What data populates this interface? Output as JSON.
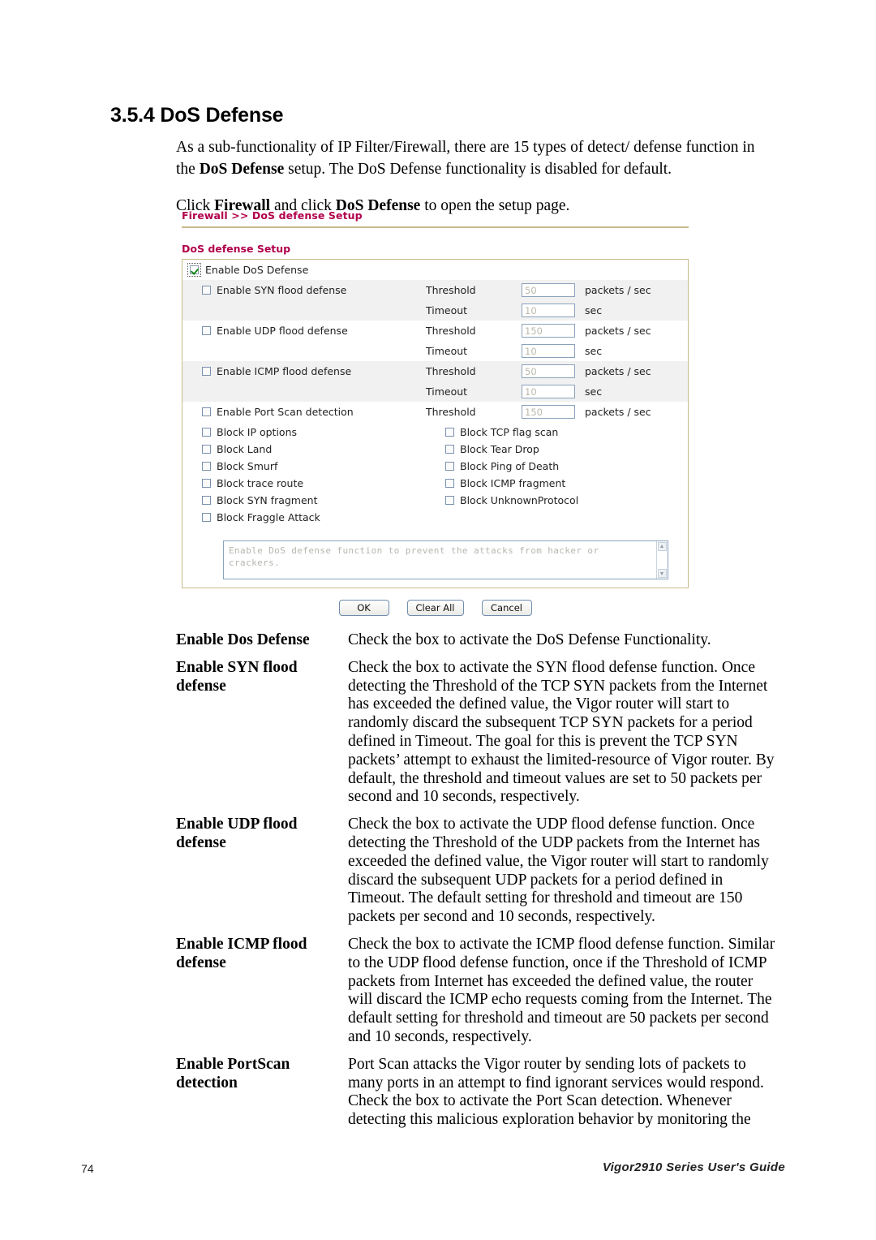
{
  "section": {
    "number": "3.5.4",
    "title": "3.5.4 DoS Defense"
  },
  "intro": {
    "paragraph1_pre": "As a sub-functionality of IP Filter/Firewall, there are 15 types of detect/ defense function in the ",
    "paragraph1_bold": "DoS Defense",
    "paragraph1_post": " setup. The DoS Defense functionality is disabled for default.",
    "paragraph2_pre": "Click ",
    "paragraph2_bold1": "Firewall",
    "paragraph2_mid": " and click ",
    "paragraph2_bold2": "DoS Defense",
    "paragraph2_post": " to open the setup page."
  },
  "screenshot": {
    "breadcrumb": "Firewall >> DoS defense Setup",
    "panel_title": "DoS defense Setup",
    "master_checkbox": {
      "label": "Enable DoS Defense",
      "checked": true
    },
    "flood_rows": [
      {
        "label": "Enable SYN flood defense",
        "checked": false,
        "threshold_label": "Threshold",
        "threshold_value": "50",
        "threshold_unit": "packets / sec",
        "timeout_label": "Timeout",
        "timeout_value": "10",
        "timeout_unit": "sec"
      },
      {
        "label": "Enable UDP flood defense",
        "checked": false,
        "threshold_label": "Threshold",
        "threshold_value": "150",
        "threshold_unit": "packets / sec",
        "timeout_label": "Timeout",
        "timeout_value": "10",
        "timeout_unit": "sec"
      },
      {
        "label": "Enable ICMP flood defense",
        "checked": false,
        "threshold_label": "Threshold",
        "threshold_value": "50",
        "threshold_unit": "packets / sec",
        "timeout_label": "Timeout",
        "timeout_value": "10",
        "timeout_unit": "sec"
      }
    ],
    "portscan_row": {
      "label": "Enable Port Scan detection",
      "checked": false,
      "threshold_label": "Threshold",
      "threshold_value": "150",
      "threshold_unit": "packets / sec"
    },
    "block_left": [
      {
        "label": "Block IP options",
        "checked": false
      },
      {
        "label": "Block Land",
        "checked": false
      },
      {
        "label": "Block Smurf",
        "checked": false
      },
      {
        "label": "Block trace route",
        "checked": false
      },
      {
        "label": "Block SYN fragment",
        "checked": false
      },
      {
        "label": "Block Fraggle Attack",
        "checked": false
      }
    ],
    "block_right": [
      {
        "label": "Block TCP flag scan",
        "checked": false
      },
      {
        "label": "Block Tear Drop",
        "checked": false
      },
      {
        "label": "Block Ping of Death",
        "checked": false
      },
      {
        "label": "Block ICMP fragment",
        "checked": false
      },
      {
        "label": "Block UnknownProtocol",
        "checked": false
      }
    ],
    "note_text": "Enable DoS defense function to prevent the attacks from hacker or crackers.",
    "buttons": {
      "ok": "OK",
      "clear_all": "Clear All",
      "cancel": "Cancel"
    },
    "colors": {
      "accent": "#b1004b",
      "panel_border": "#c8bb8a",
      "row_shade": "#f1f1f1",
      "check_green": "#1a8b1a"
    }
  },
  "definitions": [
    {
      "term": "Enable Dos Defense",
      "description": "Check the box to activate the DoS Defense Functionality."
    },
    {
      "term": "Enable SYN flood defense",
      "description": "Check the box to activate the SYN flood defense function. Once detecting the Threshold of the TCP SYN packets from the Internet has exceeded the defined value, the Vigor router will start to randomly discard the subsequent TCP SYN packets for a period defined in Timeout. The goal for this is prevent the TCP SYN packets’ attempt to exhaust the limited-resource of Vigor router. By default, the threshold and timeout values are set to 50 packets per second and 10 seconds, respectively."
    },
    {
      "term": "Enable UDP flood defense",
      "description": "Check the box to activate the UDP flood defense function. Once detecting the Threshold of the UDP packets from the Internet has exceeded the defined value, the Vigor router will start to randomly discard the subsequent UDP packets for a period defined in Timeout. The default setting for threshold and timeout are 150 packets per second and 10 seconds, respectively."
    },
    {
      "term": "Enable ICMP flood defense",
      "description": "Check the box to activate the ICMP flood defense function. Similar to the UDP flood defense function, once if the Threshold of ICMP packets from Internet has exceeded the defined value, the router will discard the ICMP echo requests coming from the Internet. The default setting for threshold and timeout are 50 packets per second and 10 seconds, respectively."
    },
    {
      "term": "Enable PortScan detection",
      "description": "Port Scan attacks the Vigor router by sending lots of packets to many ports in an attempt to find ignorant services would respond. Check the box to activate the Port Scan detection. Whenever detecting this malicious exploration behavior by monitoring the"
    }
  ],
  "footer": {
    "page_number": "74",
    "guide": "Vigor2910 Series User's Guide"
  }
}
